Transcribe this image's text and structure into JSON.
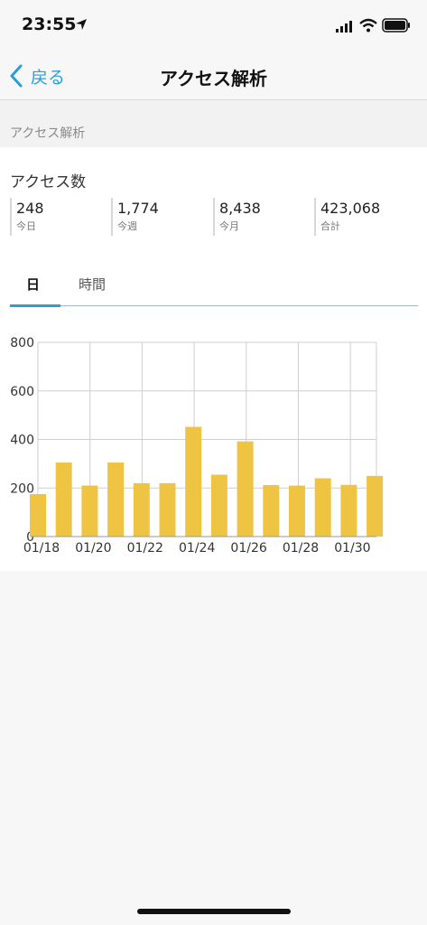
{
  "status_bar": {
    "time": "23:55"
  },
  "nav": {
    "back_label": "戻る",
    "title": "アクセス解析"
  },
  "section_header": "アクセス解析",
  "card": {
    "title": "アクセス数",
    "stats": [
      {
        "value": "248",
        "label": "今日"
      },
      {
        "value": "1,774",
        "label": "今週"
      },
      {
        "value": "8,438",
        "label": "今月"
      },
      {
        "value": "423,068",
        "label": "合計"
      }
    ],
    "tabs": [
      {
        "label": "日",
        "active": true
      },
      {
        "label": "時間",
        "active": false
      }
    ]
  },
  "colors": {
    "accent": "#2a9fd6",
    "bar": "#f0c443",
    "grid": "#cfcfcf"
  },
  "chart_data": {
    "type": "bar",
    "categories": [
      "01/18",
      "01/19",
      "01/20",
      "01/21",
      "01/22",
      "01/23",
      "01/24",
      "01/25",
      "01/26",
      "01/27",
      "01/28",
      "01/29",
      "01/30",
      "01/31"
    ],
    "x_tick_labels": [
      "01/18",
      "01/20",
      "01/22",
      "01/24",
      "01/26",
      "01/28",
      "01/30"
    ],
    "values": [
      175,
      305,
      210,
      305,
      220,
      220,
      452,
      255,
      392,
      212,
      210,
      240,
      213,
      250
    ],
    "ylim": [
      0,
      800
    ],
    "yticks": [
      "0",
      "200",
      "400",
      "600",
      "800"
    ],
    "grid": true
  }
}
